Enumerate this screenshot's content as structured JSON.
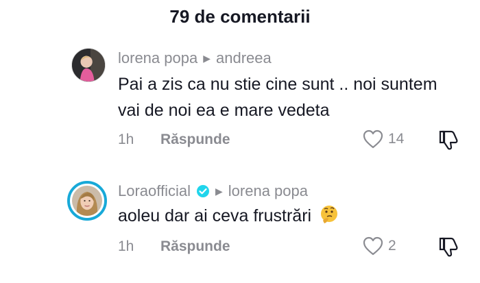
{
  "header": {
    "title": "79 de comentarii"
  },
  "comments": [
    {
      "author": "lorena popa",
      "reply_to": "andreea",
      "text": "Pai a zis ca nu stie cine sunt .. noi suntem vai de noi ea e mare vedeta",
      "time": "1h",
      "reply_label": "Răspunde",
      "likes": "14",
      "verified": false
    },
    {
      "author": "Loraofficial",
      "reply_to": "lorena popa",
      "text": "aoleu dar ai ceva frustrări",
      "emoji": "thinking-face",
      "time": "1h",
      "reply_label": "Răspunde",
      "likes": "2",
      "verified": true
    }
  ],
  "colors": {
    "text": "#161823",
    "muted": "#8a8b91",
    "verified": "#20d5ec",
    "story_ring": "#18a9d8"
  },
  "icons": [
    "play-arrow-icon",
    "verified-badge-icon",
    "heart-icon",
    "dislike-icon",
    "thinking-face-emoji"
  ]
}
